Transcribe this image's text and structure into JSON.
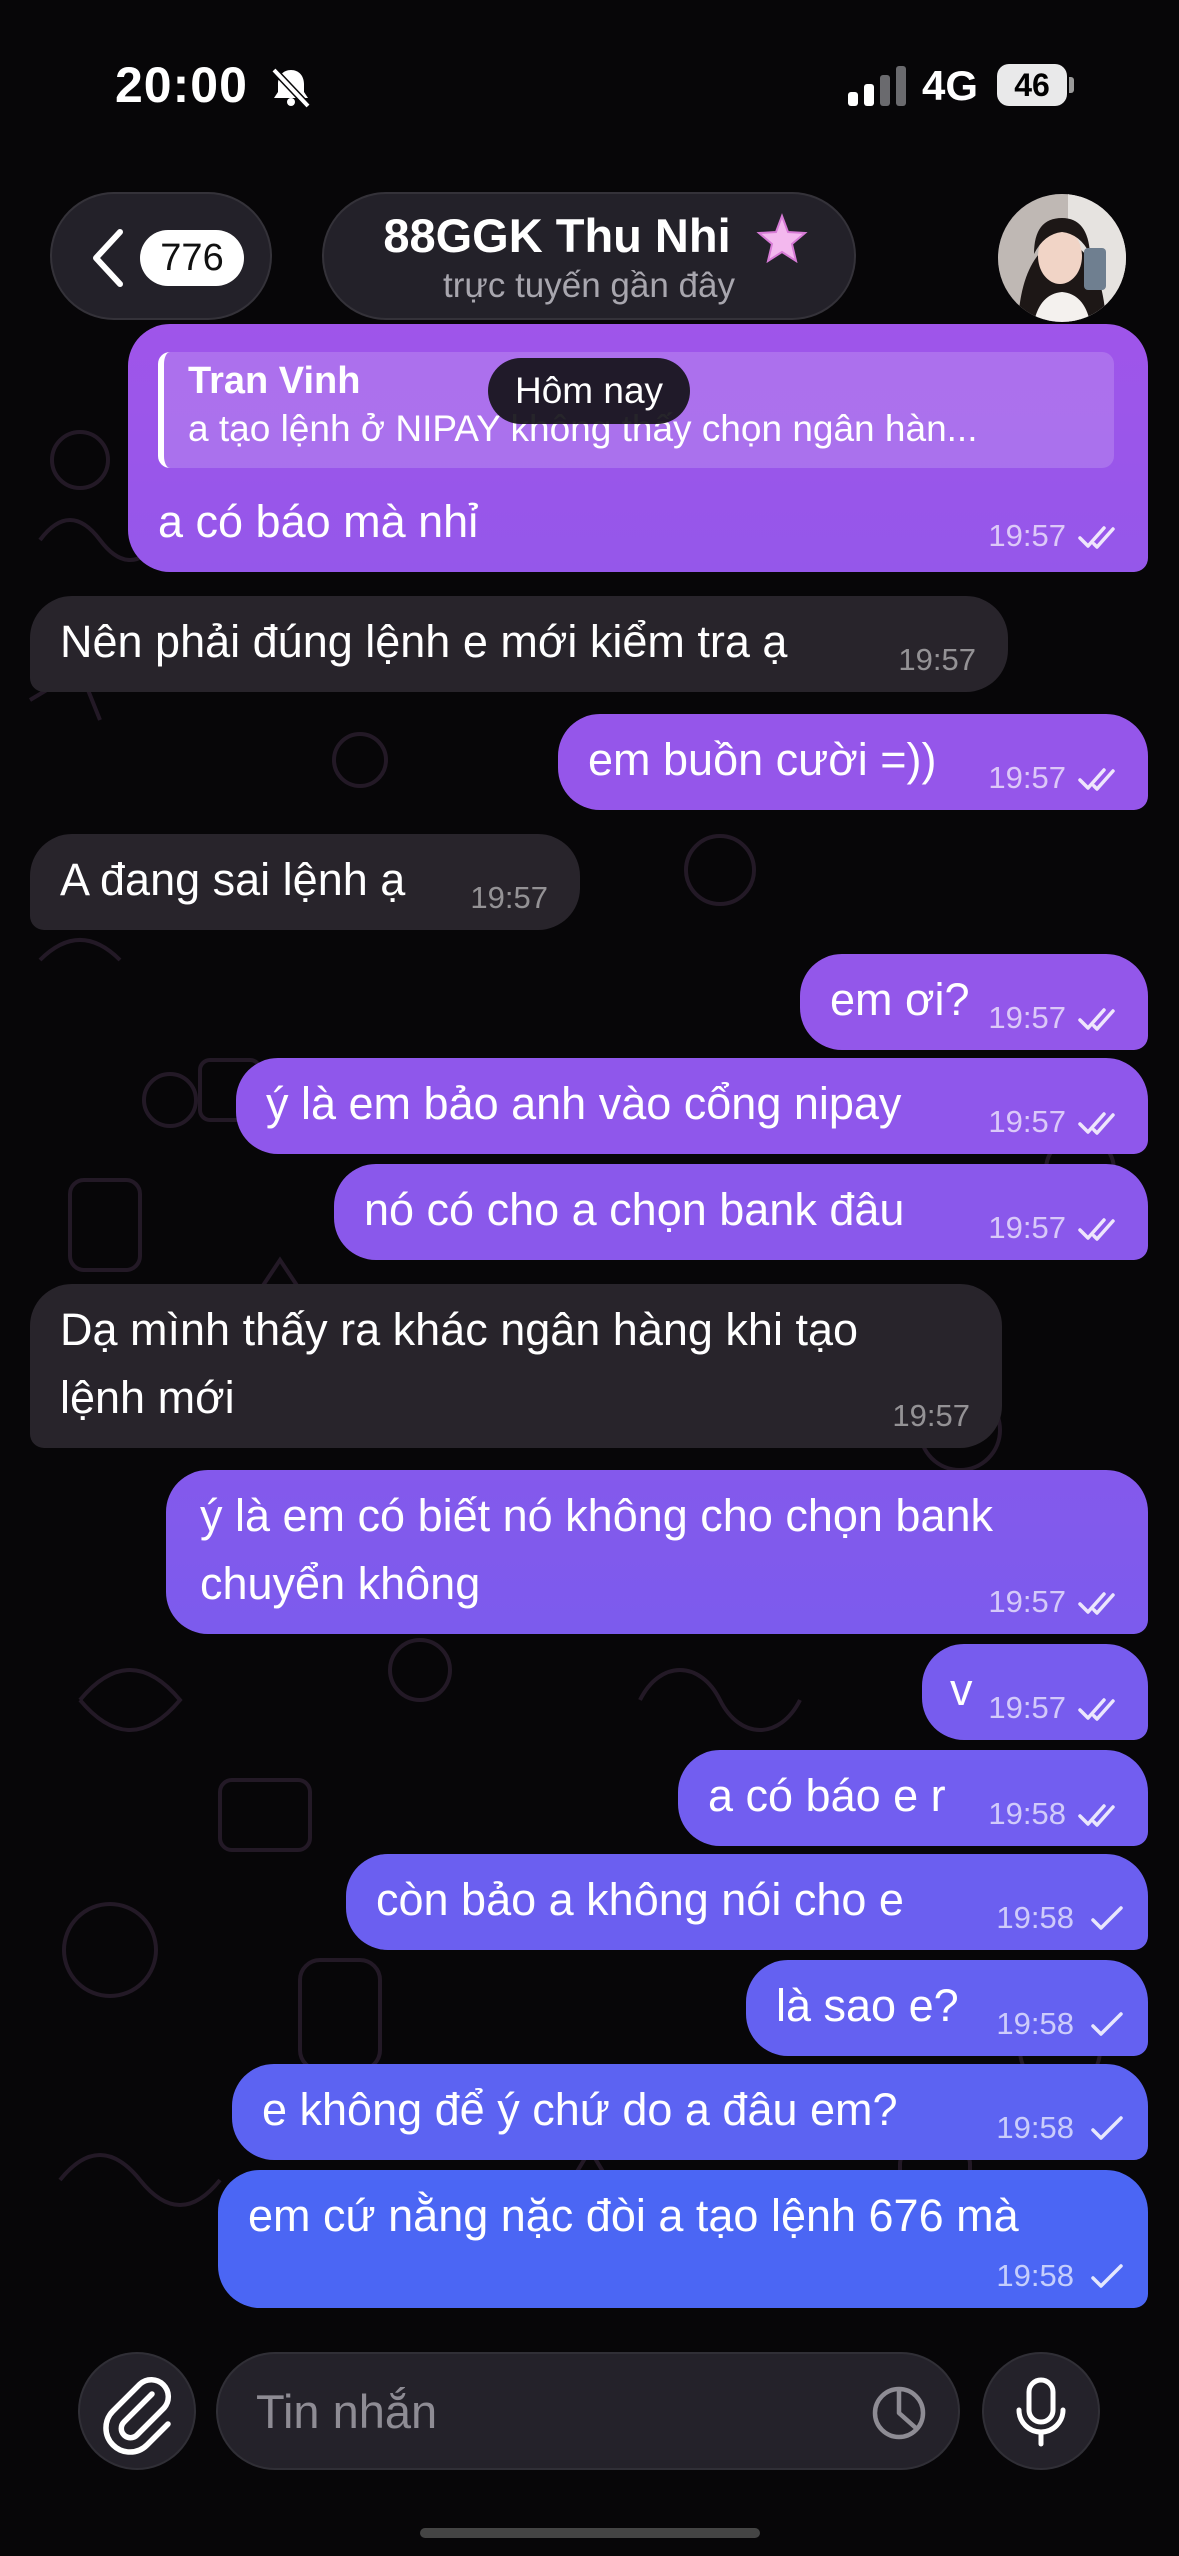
{
  "status_bar": {
    "time": "20:00",
    "network": "4G",
    "battery": "46"
  },
  "header": {
    "back_count": "776",
    "title": "88GGK Thu Nhi",
    "subtitle": "trực tuyến gần đây"
  },
  "date_separator": "Hôm nay",
  "messages": [
    {
      "dir": "out",
      "reply_name": "Tran Vinh",
      "reply_text": "a tạo lệnh ở NIPAY không thấy chọn ngân hàn...",
      "text": "a có báo mà nhỉ",
      "time": "19:57",
      "status": "read"
    },
    {
      "dir": "in",
      "text": "Nên phải đúng lệnh e mới kiểm tra ạ",
      "time": "19:57"
    },
    {
      "dir": "out",
      "text": "em buồn cười =))",
      "time": "19:57",
      "status": "read"
    },
    {
      "dir": "in",
      "text": "A đang sai lệnh ạ",
      "time": "19:57"
    },
    {
      "dir": "out",
      "text": "em ơi?",
      "time": "19:57",
      "status": "read"
    },
    {
      "dir": "out",
      "text": "ý là em bảo anh vào cổng nipay",
      "time": "19:57",
      "status": "read"
    },
    {
      "dir": "out",
      "text": "nó có cho a chọn bank đâu",
      "time": "19:57",
      "status": "read"
    },
    {
      "dir": "in",
      "line1": "Dạ mình thấy ra khác ngân hàng khi tạo",
      "line2": "lệnh mới",
      "time": "19:57"
    },
    {
      "dir": "out",
      "line1": "ý là em có biết nó không cho chọn bank",
      "line2": "chuyển không",
      "time": "19:57",
      "status": "read"
    },
    {
      "dir": "out",
      "text": "v",
      "time": "19:57",
      "status": "read"
    },
    {
      "dir": "out",
      "text": "a có báo e r",
      "time": "19:58",
      "status": "read"
    },
    {
      "dir": "out",
      "text": "còn bảo a không nói cho e",
      "time": "19:58",
      "status": "sent"
    },
    {
      "dir": "out",
      "text": "là sao e?",
      "time": "19:58",
      "status": "sent"
    },
    {
      "dir": "out",
      "text": "e không để ý chứ do a đâu em?",
      "time": "19:58",
      "status": "sent"
    },
    {
      "dir": "out",
      "text": "em cứ nằng nặc đòi a tạo lệnh 676 mà",
      "time": "19:58",
      "status": "sent"
    }
  ],
  "composer": {
    "placeholder": "Tin nhắn"
  },
  "icons": [
    "bell-slash-icon",
    "signal-icon",
    "battery-icon",
    "chevron-left-icon",
    "star-icon",
    "paperclip-icon",
    "sticker-icon",
    "microphone-icon",
    "double-check-icon",
    "single-check-icon"
  ],
  "colors": {
    "bubble_out_top": "#9a56ea",
    "bubble_out_bottom": "#3e62f4",
    "bubble_in": "#28242b",
    "background": "#070608"
  }
}
